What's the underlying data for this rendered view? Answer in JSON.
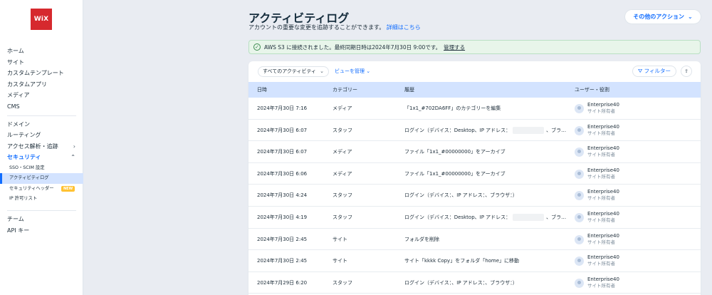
{
  "sidebar": {
    "logo": "WiX",
    "group1": [
      "ホーム",
      "サイト",
      "カスタムテンプレート",
      "カスタムアプリ",
      "メディア",
      "CMS"
    ],
    "group2": [
      {
        "label": "ドメイン",
        "chevron": ""
      },
      {
        "label": "ルーティング",
        "chevron": ""
      },
      {
        "label": "アクセス解析・追跡",
        "chevron": "›"
      },
      {
        "label": "セキュリティ",
        "chevron": "⌃"
      }
    ],
    "security_sub": [
      {
        "label": "SSO・SCIM 設定",
        "badge": ""
      },
      {
        "label": "アクティビティログ",
        "badge": ""
      },
      {
        "label": "セキュリティヘッダー",
        "badge": "NEW"
      },
      {
        "label": "IP 許可リスト",
        "badge": ""
      }
    ],
    "group3": [
      "チーム",
      "API キー"
    ]
  },
  "header": {
    "title": "アクティビティログ",
    "subtitle": "アカウントの重要な変更を追跡することができます。",
    "details_link": "詳細はこちら",
    "more_actions": "その他のアクション"
  },
  "alert": {
    "message": "AWS S3 に接続されました。最終同期日時は2024年7月30日 9:00です。",
    "manage": "管理する"
  },
  "toolbar": {
    "activity_filter": "すべてのアクティビティ",
    "manage_views": "ビューを管理",
    "filter": "フィルター"
  },
  "table": {
    "columns": [
      "日時",
      "カテゴリー",
      "履歴",
      "ユーザー・役割"
    ],
    "rows": [
      {
        "date": "2024年7月30日 7:16",
        "category": "メディア",
        "history": "「1x1_#702DA6FF」のカテゴリーを編集",
        "history_tail": "",
        "user": "Enterprise40",
        "role": "サイト所有者"
      },
      {
        "date": "2024年7月30日 6:07",
        "category": "スタッフ",
        "history": "ログイン（デバイス：Desktop、IP アドレス：",
        "history_tail": "、ブラ…",
        "user": "Enterprise40",
        "role": "サイト所有者"
      },
      {
        "date": "2024年7月30日 6:07",
        "category": "メディア",
        "history": "ファイル「1x1_#00000000」をアーカイブ",
        "history_tail": "",
        "user": "Enterprise40",
        "role": "サイト所有者"
      },
      {
        "date": "2024年7月30日 6:06",
        "category": "メディア",
        "history": "ファイル「1x1_#00000000」をアーカイブ",
        "history_tail": "",
        "user": "Enterprise40",
        "role": "サイト所有者"
      },
      {
        "date": "2024年7月30日 4:24",
        "category": "スタッフ",
        "history": "ログイン（デバイス：、IP アドレス：、ブラウザ：）",
        "history_tail": "",
        "user": "Enterprise40",
        "role": "サイト所有者"
      },
      {
        "date": "2024年7月30日 4:19",
        "category": "スタッフ",
        "history": "ログイン（デバイス：Desktop、IP アドレス：",
        "history_tail": "、ブラ…",
        "user": "Enterprise40",
        "role": "サイト所有者"
      },
      {
        "date": "2024年7月30日 2:45",
        "category": "サイト",
        "history": "フォルダを削除",
        "history_tail": "",
        "user": "Enterprise40",
        "role": "サイト所有者"
      },
      {
        "date": "2024年7月30日 2:45",
        "category": "サイト",
        "history": "サイト「kkkk Copy」をフォルダ「home」に移動",
        "history_tail": "",
        "user": "Enterprise40",
        "role": "サイト所有者"
      },
      {
        "date": "2024年7月29日 6:20",
        "category": "スタッフ",
        "history": "ログイン（デバイス：、IP アドレス：、ブラウザ：）",
        "history_tail": "",
        "user": "Enterprise40",
        "role": "サイト所有者"
      }
    ]
  }
}
